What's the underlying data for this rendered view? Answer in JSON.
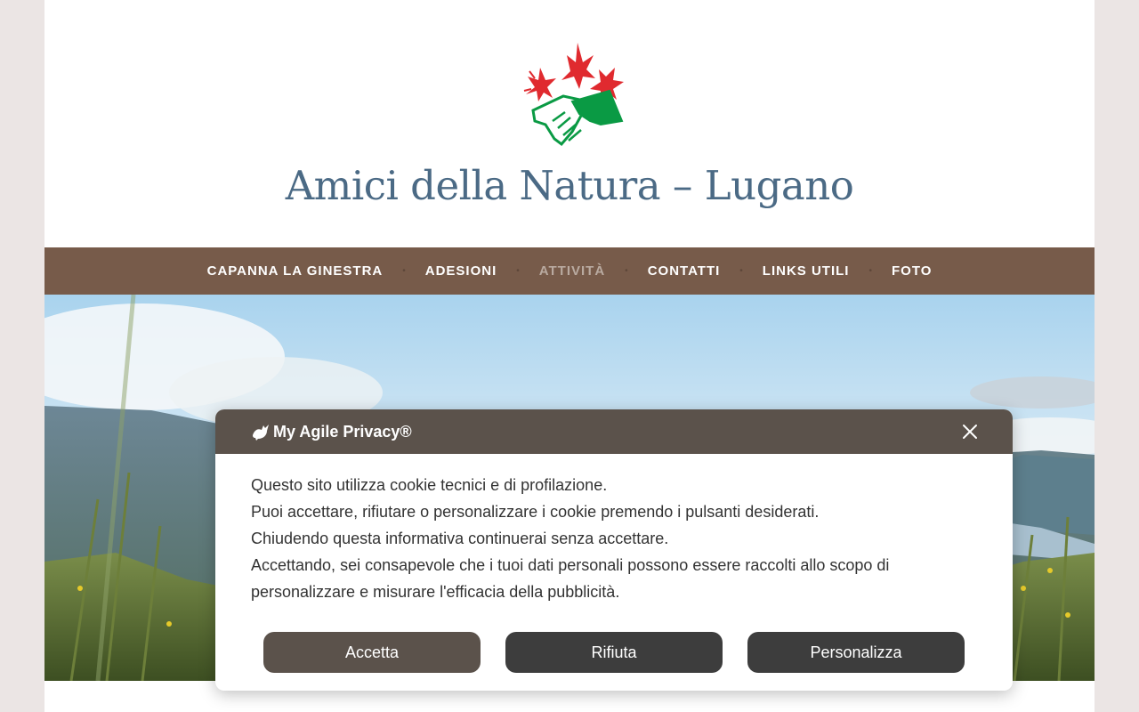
{
  "header": {
    "site_title": "Amici della Natura – Lugano",
    "logo_icon": "handshake-flowers-logo-icon"
  },
  "nav": {
    "items": [
      {
        "label": "CAPANNA LA GINESTRA",
        "active": false
      },
      {
        "label": "ADESIONI",
        "active": false
      },
      {
        "label": "ATTIVITÀ",
        "active": true
      },
      {
        "label": "CONTATTI",
        "active": false
      },
      {
        "label": "LINKS UTILI",
        "active": false
      },
      {
        "label": "FOTO",
        "active": false
      }
    ],
    "separator": "•"
  },
  "hero": {
    "image": "mountain-landscape-photo"
  },
  "cookie_banner": {
    "brand": "My Agile Privacy®",
    "brand_icon": "rooster-icon",
    "close_icon": "close-icon",
    "lines": [
      "Questo sito utilizza cookie tecnici e di profilazione.",
      "Puoi accettare, rifiutare o personalizzare i cookie premendo i pulsanti desiderati.",
      "Chiudendo questa informativa continuerai senza accettare.",
      "Accettando, sei consapevole che i tuoi dati personali possono essere raccolti allo scopo di personalizzare e misurare l'efficacia della pubblicità."
    ],
    "buttons": {
      "accept": "Accetta",
      "reject": "Rifiuta",
      "customize": "Personalizza"
    }
  },
  "colors": {
    "nav_bg": "#775b4a",
    "title": "#4b6a85",
    "banner_head": "#5b524b",
    "button_dark": "#3d3d3d"
  }
}
